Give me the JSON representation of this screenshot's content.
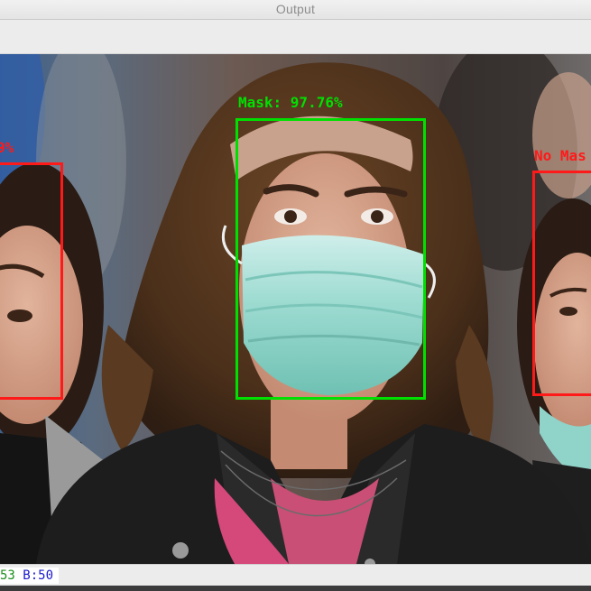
{
  "window": {
    "title": "Output"
  },
  "detections": [
    {
      "label": "9%",
      "color": "#ff1a1a"
    },
    {
      "label": "Mask: 97.76%",
      "color": "#00e000"
    },
    {
      "label": "No Mas",
      "color": "#ff1a1a"
    }
  ],
  "status": {
    "readout_start": "53",
    "readout_b": "B:50",
    "green_color": "#1a8f1a",
    "blue_color": "#1a1acc"
  }
}
